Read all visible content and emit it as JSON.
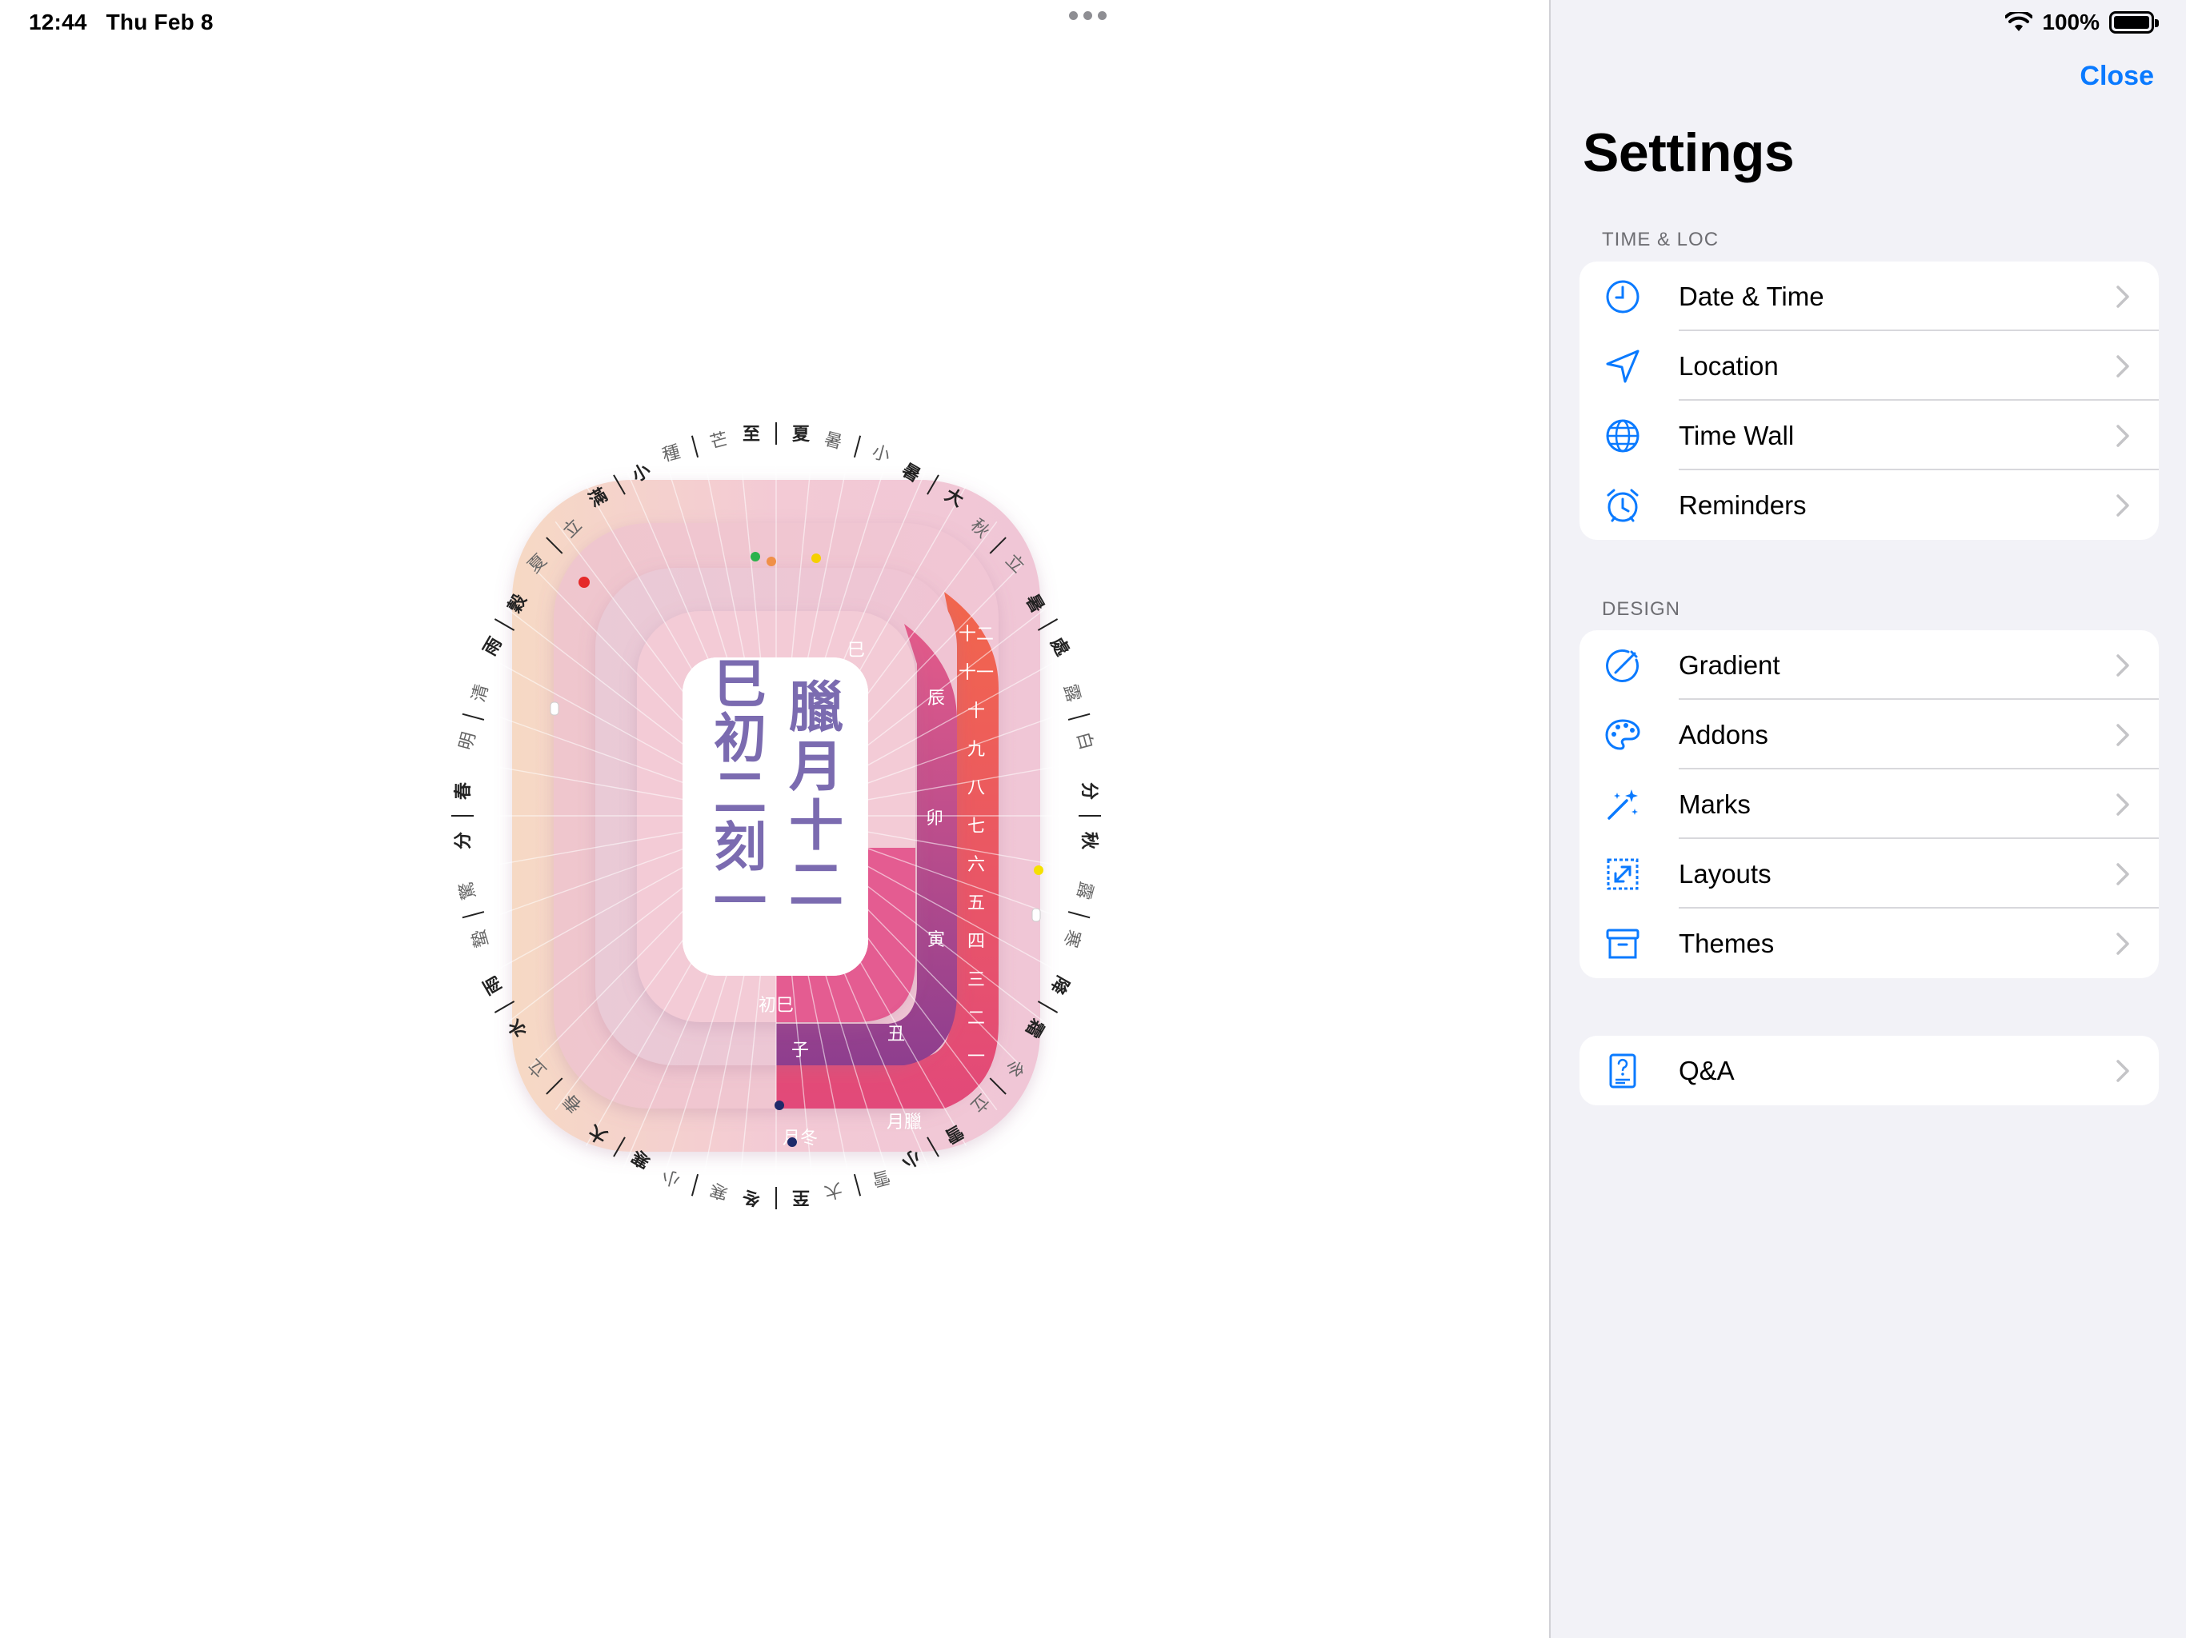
{
  "status_bar": {
    "time": "12:44",
    "date": "Thu Feb 8",
    "battery_percent": "100%",
    "battery_level": 1.0
  },
  "clock_face": {
    "month_text": "臘月十二",
    "hour_text": "巳初二刻一",
    "month_color": "#7b6bb0",
    "hour_color": "#7b6bb0",
    "terms": [
      "夏至",
      "小暑",
      "大暑",
      "立秋",
      "處暑",
      "白露",
      "秋分",
      "寒露",
      "霜降",
      "立冬",
      "小雪",
      "大雪",
      "冬至",
      "小寒",
      "大寒",
      "立春",
      "雨水",
      "驚蟄",
      "春分",
      "清明",
      "穀雨",
      "立夏",
      "小滿",
      "芒種"
    ],
    "ring_labels": {
      "month_numbers": [
        "十二",
        "十一",
        "十",
        "九",
        "八",
        "七",
        "六",
        "五",
        "四",
        "三",
        "二",
        "一"
      ],
      "branches": [
        "巳",
        "辰",
        "卯",
        "寅",
        "丑",
        "子"
      ],
      "bottom_tags": [
        "月冬",
        "月臘",
        "初巳"
      ]
    }
  },
  "settings": {
    "close_label": "Close",
    "title": "Settings",
    "sections": [
      {
        "header": "TIME & LOC",
        "rows": [
          {
            "label": "Date & Time",
            "icon": "clock-icon"
          },
          {
            "label": "Location",
            "icon": "location-arrow-icon"
          },
          {
            "label": "Time Wall",
            "icon": "globe-icon"
          },
          {
            "label": "Reminders",
            "icon": "alarm-icon"
          }
        ]
      },
      {
        "header": "DESIGN",
        "rows": [
          {
            "label": "Gradient",
            "icon": "gradient-icon"
          },
          {
            "label": "Addons",
            "icon": "palette-icon"
          },
          {
            "label": "Marks",
            "icon": "magic-wand-icon"
          },
          {
            "label": "Layouts",
            "icon": "resize-icon"
          },
          {
            "label": "Themes",
            "icon": "archive-box-icon"
          }
        ]
      },
      {
        "header": "",
        "rows": [
          {
            "label": "Q&A",
            "icon": "question-doc-icon"
          }
        ]
      }
    ]
  },
  "colors": {
    "accent": "#0a7aff",
    "panel_bg": "#f2f2f7"
  }
}
